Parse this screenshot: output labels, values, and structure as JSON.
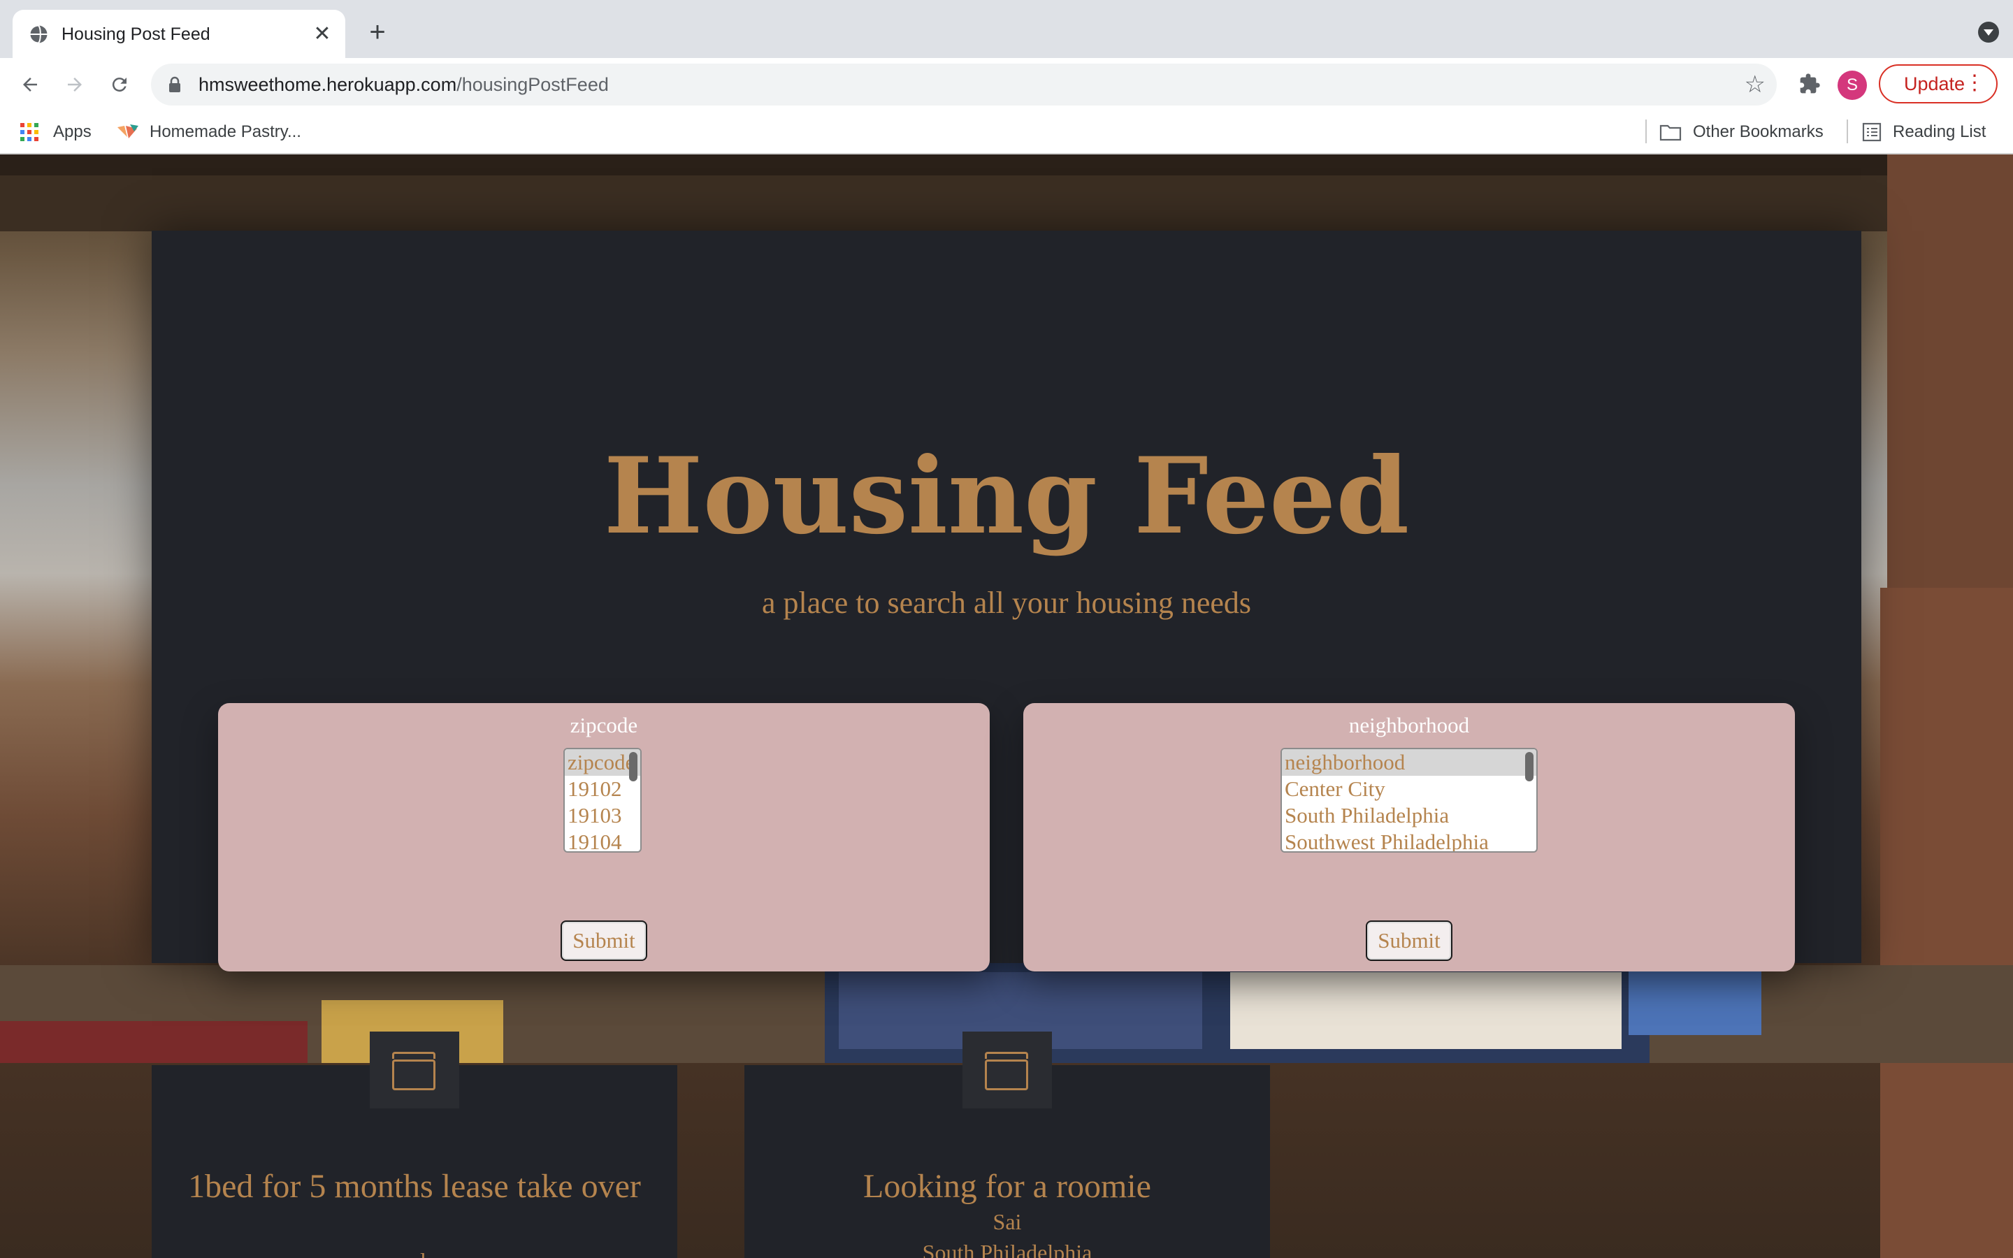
{
  "browser": {
    "tab_title": "Housing Post Feed",
    "url_host": "hmsweethome.herokuapp.com",
    "url_path": "/housingPostFeed",
    "avatar_letter": "S",
    "update_label": "Update",
    "bookmarks": {
      "apps": "Apps",
      "pastry": "Homemade Pastry...",
      "other": "Other Bookmarks",
      "reading": "Reading List"
    }
  },
  "page": {
    "title": "Housing Feed",
    "subtitle": "a place to search all your housing needs",
    "zip_search": {
      "label": "zipcode",
      "options": [
        "zipcode",
        "19102",
        "19103",
        "19104"
      ],
      "submit": "Submit"
    },
    "hood_search": {
      "label": "neighborhood",
      "options": [
        "neighborhood",
        "Center City",
        "South Philadelphia",
        "Southwest Philadelphia"
      ],
      "submit": "Submit"
    },
    "posts": [
      {
        "title": "1bed for 5 months lease take over",
        "meta1": "male"
      },
      {
        "title": "Looking for a roomie",
        "meta1": "Sai",
        "meta2": "South Philadelphia"
      }
    ]
  },
  "colors": {
    "accent": "#b5844e",
    "panel": "#212329",
    "search_card": "#d2b1b1"
  }
}
